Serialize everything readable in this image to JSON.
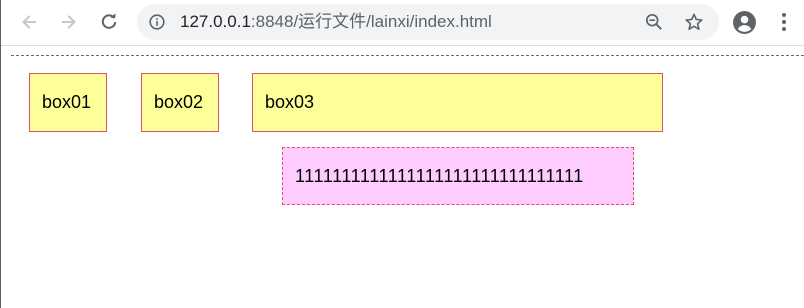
{
  "toolbar": {
    "back_icon": "arrow-left-icon",
    "forward_icon": "arrow-right-icon",
    "reload_icon": "reload-icon",
    "url_host": "127.0.0.1",
    "url_rest": ":8848/运行文件/lainxi/index.html",
    "info_icon": "info-icon",
    "zoom_icon": "zoom-out-icon",
    "star_icon": "star-icon",
    "profile_icon": "account-circle-icon",
    "menu_icon": "more-vert-icon"
  },
  "page": {
    "box01": "box01",
    "box02": "box02",
    "box03": "box03",
    "pink_text": "1111111111111111111111111111111"
  },
  "colors": {
    "yellow_box": "#ffff99",
    "pink_box": "#ffccff",
    "border": "#e0506a"
  }
}
